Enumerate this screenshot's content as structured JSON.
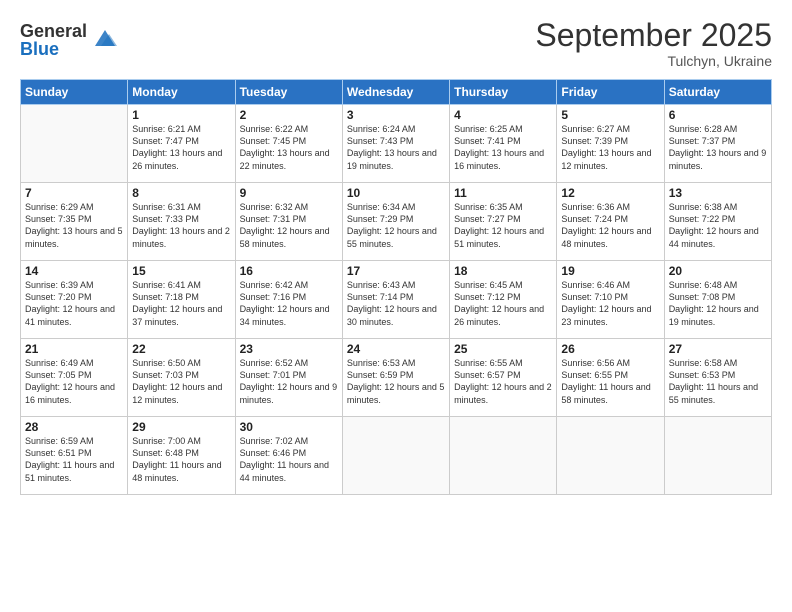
{
  "logo": {
    "general": "General",
    "blue": "Blue"
  },
  "title": "September 2025",
  "subtitle": "Tulchyn, Ukraine",
  "days_of_week": [
    "Sunday",
    "Monday",
    "Tuesday",
    "Wednesday",
    "Thursday",
    "Friday",
    "Saturday"
  ],
  "weeks": [
    [
      {
        "day": "",
        "sunrise": "",
        "sunset": "",
        "daylight": ""
      },
      {
        "day": "1",
        "sunrise": "Sunrise: 6:21 AM",
        "sunset": "Sunset: 7:47 PM",
        "daylight": "Daylight: 13 hours and 26 minutes."
      },
      {
        "day": "2",
        "sunrise": "Sunrise: 6:22 AM",
        "sunset": "Sunset: 7:45 PM",
        "daylight": "Daylight: 13 hours and 22 minutes."
      },
      {
        "day": "3",
        "sunrise": "Sunrise: 6:24 AM",
        "sunset": "Sunset: 7:43 PM",
        "daylight": "Daylight: 13 hours and 19 minutes."
      },
      {
        "day": "4",
        "sunrise": "Sunrise: 6:25 AM",
        "sunset": "Sunset: 7:41 PM",
        "daylight": "Daylight: 13 hours and 16 minutes."
      },
      {
        "day": "5",
        "sunrise": "Sunrise: 6:27 AM",
        "sunset": "Sunset: 7:39 PM",
        "daylight": "Daylight: 13 hours and 12 minutes."
      },
      {
        "day": "6",
        "sunrise": "Sunrise: 6:28 AM",
        "sunset": "Sunset: 7:37 PM",
        "daylight": "Daylight: 13 hours and 9 minutes."
      }
    ],
    [
      {
        "day": "7",
        "sunrise": "Sunrise: 6:29 AM",
        "sunset": "Sunset: 7:35 PM",
        "daylight": "Daylight: 13 hours and 5 minutes."
      },
      {
        "day": "8",
        "sunrise": "Sunrise: 6:31 AM",
        "sunset": "Sunset: 7:33 PM",
        "daylight": "Daylight: 13 hours and 2 minutes."
      },
      {
        "day": "9",
        "sunrise": "Sunrise: 6:32 AM",
        "sunset": "Sunset: 7:31 PM",
        "daylight": "Daylight: 12 hours and 58 minutes."
      },
      {
        "day": "10",
        "sunrise": "Sunrise: 6:34 AM",
        "sunset": "Sunset: 7:29 PM",
        "daylight": "Daylight: 12 hours and 55 minutes."
      },
      {
        "day": "11",
        "sunrise": "Sunrise: 6:35 AM",
        "sunset": "Sunset: 7:27 PM",
        "daylight": "Daylight: 12 hours and 51 minutes."
      },
      {
        "day": "12",
        "sunrise": "Sunrise: 6:36 AM",
        "sunset": "Sunset: 7:24 PM",
        "daylight": "Daylight: 12 hours and 48 minutes."
      },
      {
        "day": "13",
        "sunrise": "Sunrise: 6:38 AM",
        "sunset": "Sunset: 7:22 PM",
        "daylight": "Daylight: 12 hours and 44 minutes."
      }
    ],
    [
      {
        "day": "14",
        "sunrise": "Sunrise: 6:39 AM",
        "sunset": "Sunset: 7:20 PM",
        "daylight": "Daylight: 12 hours and 41 minutes."
      },
      {
        "day": "15",
        "sunrise": "Sunrise: 6:41 AM",
        "sunset": "Sunset: 7:18 PM",
        "daylight": "Daylight: 12 hours and 37 minutes."
      },
      {
        "day": "16",
        "sunrise": "Sunrise: 6:42 AM",
        "sunset": "Sunset: 7:16 PM",
        "daylight": "Daylight: 12 hours and 34 minutes."
      },
      {
        "day": "17",
        "sunrise": "Sunrise: 6:43 AM",
        "sunset": "Sunset: 7:14 PM",
        "daylight": "Daylight: 12 hours and 30 minutes."
      },
      {
        "day": "18",
        "sunrise": "Sunrise: 6:45 AM",
        "sunset": "Sunset: 7:12 PM",
        "daylight": "Daylight: 12 hours and 26 minutes."
      },
      {
        "day": "19",
        "sunrise": "Sunrise: 6:46 AM",
        "sunset": "Sunset: 7:10 PM",
        "daylight": "Daylight: 12 hours and 23 minutes."
      },
      {
        "day": "20",
        "sunrise": "Sunrise: 6:48 AM",
        "sunset": "Sunset: 7:08 PM",
        "daylight": "Daylight: 12 hours and 19 minutes."
      }
    ],
    [
      {
        "day": "21",
        "sunrise": "Sunrise: 6:49 AM",
        "sunset": "Sunset: 7:05 PM",
        "daylight": "Daylight: 12 hours and 16 minutes."
      },
      {
        "day": "22",
        "sunrise": "Sunrise: 6:50 AM",
        "sunset": "Sunset: 7:03 PM",
        "daylight": "Daylight: 12 hours and 12 minutes."
      },
      {
        "day": "23",
        "sunrise": "Sunrise: 6:52 AM",
        "sunset": "Sunset: 7:01 PM",
        "daylight": "Daylight: 12 hours and 9 minutes."
      },
      {
        "day": "24",
        "sunrise": "Sunrise: 6:53 AM",
        "sunset": "Sunset: 6:59 PM",
        "daylight": "Daylight: 12 hours and 5 minutes."
      },
      {
        "day": "25",
        "sunrise": "Sunrise: 6:55 AM",
        "sunset": "Sunset: 6:57 PM",
        "daylight": "Daylight: 12 hours and 2 minutes."
      },
      {
        "day": "26",
        "sunrise": "Sunrise: 6:56 AM",
        "sunset": "Sunset: 6:55 PM",
        "daylight": "Daylight: 11 hours and 58 minutes."
      },
      {
        "day": "27",
        "sunrise": "Sunrise: 6:58 AM",
        "sunset": "Sunset: 6:53 PM",
        "daylight": "Daylight: 11 hours and 55 minutes."
      }
    ],
    [
      {
        "day": "28",
        "sunrise": "Sunrise: 6:59 AM",
        "sunset": "Sunset: 6:51 PM",
        "daylight": "Daylight: 11 hours and 51 minutes."
      },
      {
        "day": "29",
        "sunrise": "Sunrise: 7:00 AM",
        "sunset": "Sunset: 6:48 PM",
        "daylight": "Daylight: 11 hours and 48 minutes."
      },
      {
        "day": "30",
        "sunrise": "Sunrise: 7:02 AM",
        "sunset": "Sunset: 6:46 PM",
        "daylight": "Daylight: 11 hours and 44 minutes."
      },
      {
        "day": "",
        "sunrise": "",
        "sunset": "",
        "daylight": ""
      },
      {
        "day": "",
        "sunrise": "",
        "sunset": "",
        "daylight": ""
      },
      {
        "day": "",
        "sunrise": "",
        "sunset": "",
        "daylight": ""
      },
      {
        "day": "",
        "sunrise": "",
        "sunset": "",
        "daylight": ""
      }
    ]
  ]
}
